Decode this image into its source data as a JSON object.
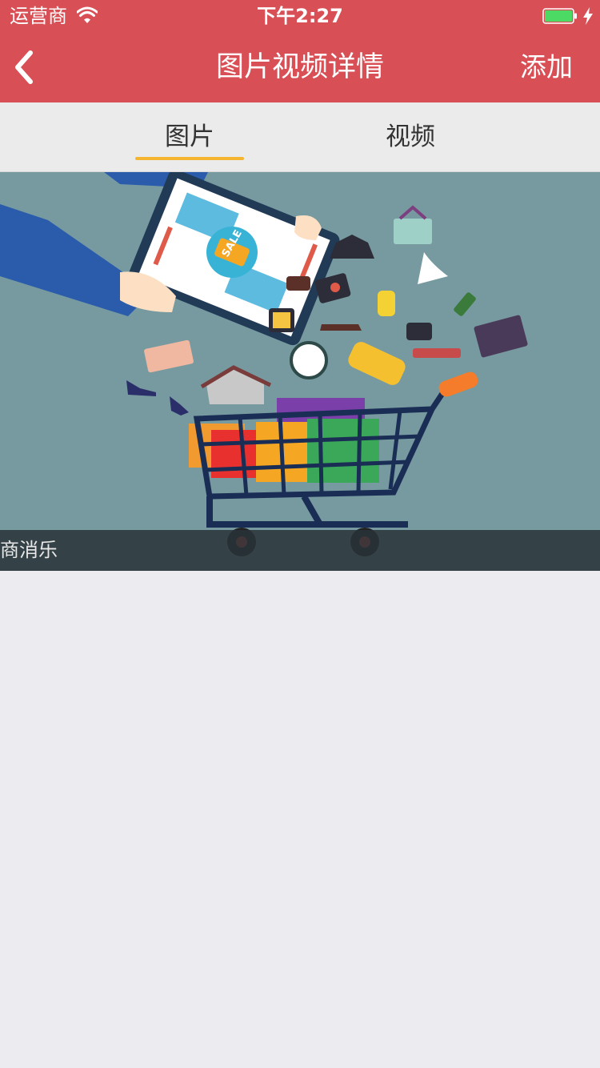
{
  "status_bar": {
    "carrier": "运营商",
    "time": "下午2:27",
    "icons": [
      "wifi-icon",
      "battery-icon",
      "charging-bolt-icon"
    ],
    "battery_color": "#4cd964"
  },
  "nav": {
    "title": "图片视频详情",
    "add_label": "添加",
    "back_icon": "chevron-left-icon",
    "background": "#d84f55"
  },
  "tabs": {
    "items": [
      {
        "label": "图片",
        "selected": true
      },
      {
        "label": "视频",
        "selected": false
      }
    ],
    "indicator_color": "#f5b531"
  },
  "media": {
    "sale_tag": "SALE",
    "caption": "商消乐"
  }
}
